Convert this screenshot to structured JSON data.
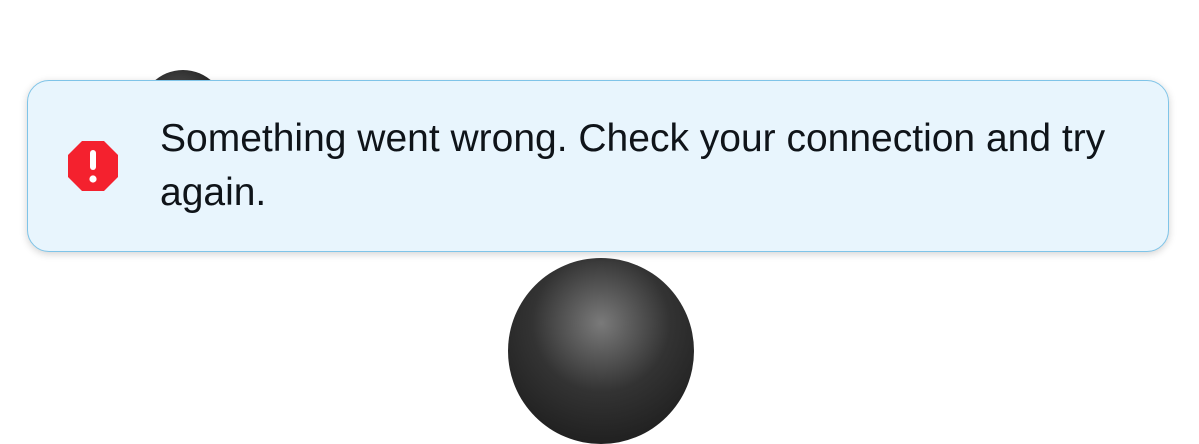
{
  "toast": {
    "icon": "alert-octagon-icon",
    "icon_color": "#f4212e",
    "background_color": "#e8f5fd",
    "border_color": "#7fc4e8",
    "message": "Something went wrong. Check your connection and try again."
  }
}
